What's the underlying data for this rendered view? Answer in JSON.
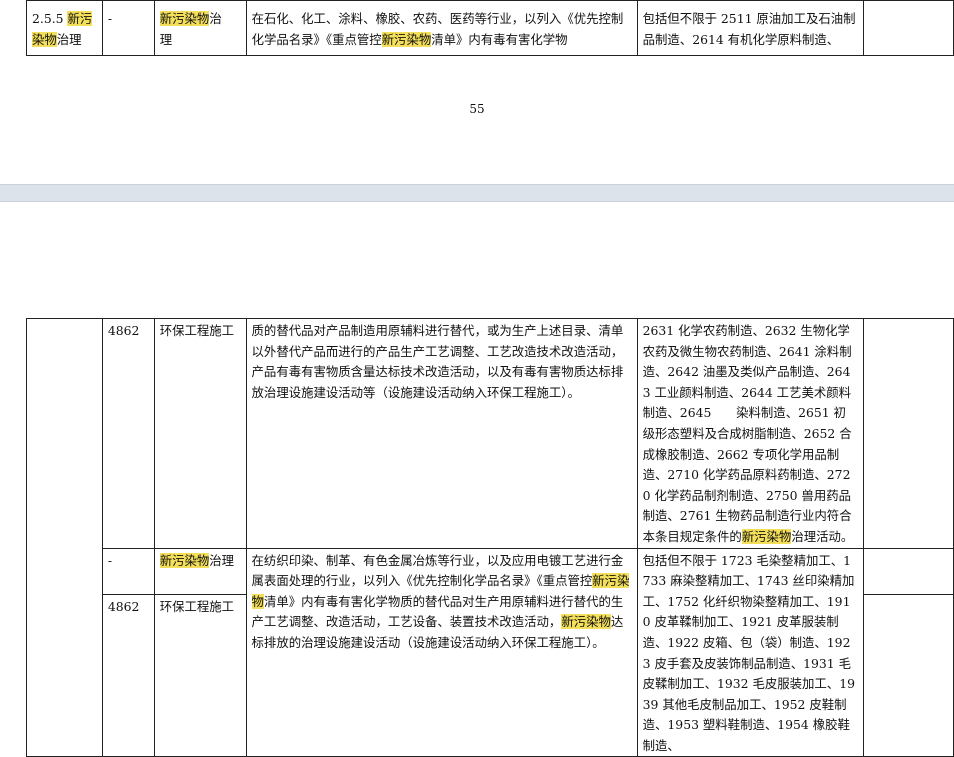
{
  "top_row": {
    "code": "2.5.5",
    "name_hl1": "新污",
    "name_hl2": "染物",
    "name_rest": "治理",
    "industry_code": "-",
    "category_hl": "新污染物",
    "category_rest": "治",
    "category_rest2": "理",
    "description_a": "在石化、化工、涂料、橡胶、农药、医药等行业，以列入《优先控制化学品名录》《重点管控",
    "description_hl": "新污染物",
    "description_b": "清单》内有毒有害化学物",
    "scope": "包括但不限于 2511 原油加工及石油制品制造、2614 有机化学原料制造、"
  },
  "page_number": "55",
  "row_a": {
    "industry_code": "4862",
    "category": "环保工程施工",
    "description": "质的替代品对产品制造用原辅料进行替代，或为生产上述目录、清单以外替代产品而进行的产品生产工艺调整、工艺改造技术改造活动，产品有毒有害物质含量达标技术改造活动，以及有毒有害物质达标排放治理设施建设活动等（设施建设活动纳入环保工程施工）。",
    "scope_a": "2631 化学农药制造、2632 生物化学农药及微生物农药制造、2641 涂料制造、2642 油墨及类似产品制造、2643 工业颜料制造、2644 工艺美术颜料制造、2645　　染料制造、2651 初级形态塑料及合成树脂制造、2652 合成橡胶制造、2662 专项化学用品制造、2710 化学药品原料药制造、2720 化学药品制剂制造、2750 兽用药品制造、2761 生物药品制造行业内符合本条目规定条件的",
    "scope_hl": "新污染物",
    "scope_b": "治理活动。"
  },
  "row_b": {
    "industry_code": "-",
    "category_hl": "新污染物",
    "category_rest": "治理"
  },
  "row_c": {
    "industry_code": "4862",
    "category": "环保工程施工",
    "description_a": "在纺织印染、制革、有色金属冶炼等行业，以及应用电镀工艺进行金属表面处理的行业，以列入《优先控制化学品名录》《重点管控",
    "description_hl1": "新污染物",
    "description_b": "清单》内有毒有害化学物质的替代品对生产用原辅料进行替代的生产工艺调整、改造活动，工艺设备、装置技术改造活动，",
    "description_hl2": "新污染物",
    "description_c": "达标排放的治理设施建设活动（设施建设活动纳入环保工程施工）。",
    "scope": "包括但不限于 1723 毛染整精加工、1733 麻染整精加工、1743 丝印染精加工、1752 化纤织物染整精加工、1910 皮革鞣制加工、1921 皮革服装制造、1922 皮箱、包（袋）制造、1923 皮手套及皮装饰制品制造、1931 毛皮鞣制加工、1932 毛皮服装加工、1939 其他毛皮制品加工、1952 皮鞋制造、1953 塑料鞋制造、1954 橡胶鞋制造、"
  }
}
